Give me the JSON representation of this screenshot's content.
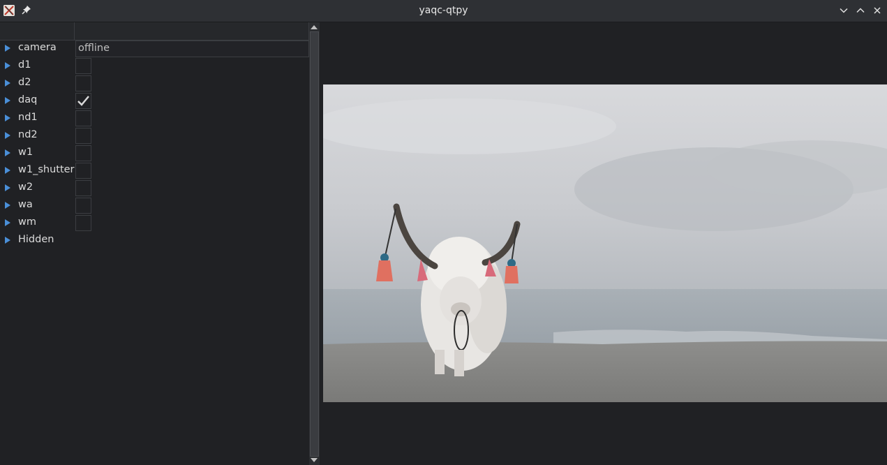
{
  "window": {
    "title": "yaqc-qtpy",
    "icons": {
      "app": "x-app-icon",
      "pin": "pin-icon",
      "minimize": "chevron-down-icon",
      "maximize": "chevron-up-icon",
      "close": "close-icon"
    }
  },
  "tree": {
    "rows": [
      {
        "label": "camera",
        "type": "text",
        "value": "offline"
      },
      {
        "label": "d1",
        "type": "checkbox",
        "checked": false
      },
      {
        "label": "d2",
        "type": "checkbox",
        "checked": false
      },
      {
        "label": "daq",
        "type": "checkbox",
        "checked": true
      },
      {
        "label": "nd1",
        "type": "checkbox",
        "checked": false
      },
      {
        "label": "nd2",
        "type": "checkbox",
        "checked": false
      },
      {
        "label": "w1",
        "type": "checkbox",
        "checked": false
      },
      {
        "label": "w1_shutter",
        "type": "checkbox",
        "checked": false
      },
      {
        "label": "w2",
        "type": "checkbox",
        "checked": false
      },
      {
        "label": "wa",
        "type": "checkbox",
        "checked": false
      },
      {
        "label": "wm",
        "type": "checkbox",
        "checked": false
      },
      {
        "label": "Hidden",
        "type": "group"
      }
    ]
  },
  "colors": {
    "accent_arrow": "#4a8fd8",
    "background": "#202124",
    "titlebar": "#2e3034"
  }
}
